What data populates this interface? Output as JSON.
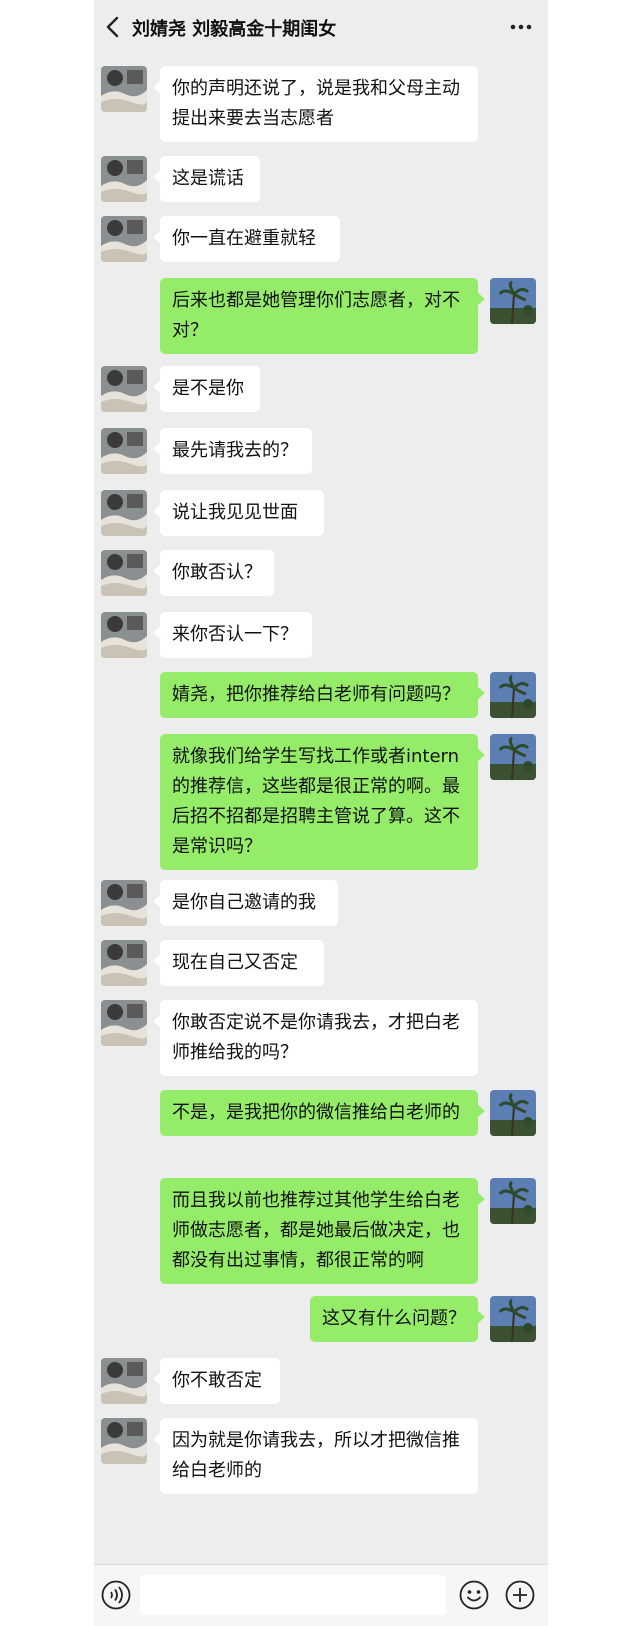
{
  "header": {
    "title": "刘婧尧 刘毅高金十期闺女"
  },
  "messages": [
    {
      "side": "left",
      "text": "你的声明还说了，说是我和父母主动提出来要去当志愿者"
    },
    {
      "side": "left",
      "text": "这是谎话"
    },
    {
      "side": "left",
      "text": "你一直在避重就轻"
    },
    {
      "side": "right",
      "text": "后来也都是她管理你们志愿者，对不对？"
    },
    {
      "side": "left",
      "text": "是不是你"
    },
    {
      "side": "left",
      "text": "最先请我去的？"
    },
    {
      "side": "left",
      "text": "说让我见见世面"
    },
    {
      "side": "left",
      "text": "你敢否认？"
    },
    {
      "side": "left",
      "text": "来你否认一下？"
    },
    {
      "side": "right",
      "text": "婧尧，把你推荐给白老师有问题吗？"
    },
    {
      "side": "right",
      "text": "就像我们给学生写找工作或者intern 的推荐信，这些都是很正常的啊。最后招不招都是招聘主管说了算。这不是常识吗？"
    },
    {
      "side": "left",
      "text": "是你自己邀请的我"
    },
    {
      "side": "left",
      "text": "现在自己又否定"
    },
    {
      "side": "left",
      "text": "你敢否定说不是你请我去，才把白老师推给我的吗？"
    },
    {
      "side": "right",
      "text": "不是，是我把你的微信推给白老师的"
    },
    {
      "side": "right",
      "text": "而且我以前也推荐过其他学生给白老师做志愿者，都是她最后做决定，也都没有出过事情，都很正常的啊"
    },
    {
      "side": "right",
      "text": "这又有什么问题？"
    },
    {
      "side": "left",
      "text": "你不敢否定"
    },
    {
      "side": "left",
      "text": "因为就是你请我去，所以才把微信推给白老师的"
    }
  ],
  "icons": {
    "back": "chevron-left-icon",
    "more": "more-dots-icon",
    "voice": "voice-icon",
    "emoji": "emoji-icon",
    "plus": "plus-icon"
  },
  "colors": {
    "background": "#ededed",
    "incoming_bubble": "#ffffff",
    "outgoing_bubble": "#95ec69"
  }
}
